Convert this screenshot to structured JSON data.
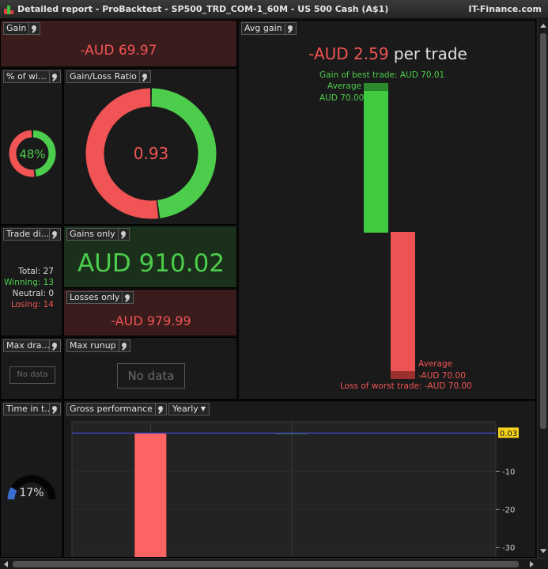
{
  "window": {
    "title": "Detailed report - ProBacktest - SP500_TRD_COM-1_60M - US 500 Cash (A$1)",
    "brand": "IT-Finance.com"
  },
  "gain": {
    "label": "Gain",
    "value": "-AUD 69.97"
  },
  "pct_winning": {
    "label": "% of wi...",
    "value": "48%",
    "fraction": 0.48
  },
  "gain_loss_ratio": {
    "label": "Gain/Loss Ratio",
    "value": "0.93",
    "green_fraction": 0.48
  },
  "avg_gain": {
    "label": "Avg gain",
    "value": "-AUD 2.59",
    "suffix": "per trade",
    "best_label": "Gain of best trade: AUD 70.01",
    "avg_pos_label": "Average",
    "avg_pos_value": "AUD 70.00",
    "avg_neg_label": "Average",
    "avg_neg_value": "-AUD 70.00",
    "worst_label": "Loss of worst trade: -AUD 70.00"
  },
  "trade_dist": {
    "label": "Trade di...",
    "total_label": "Total:",
    "total": "27",
    "winning_label": "Winning:",
    "winning": "13",
    "neutral_label": "Neutral:",
    "neutral": "0",
    "losing_label": "Losing:",
    "losing": "14"
  },
  "gains_only": {
    "label": "Gains only",
    "value": "AUD 910.02"
  },
  "losses_only": {
    "label": "Losses only",
    "value": "-AUD 979.99"
  },
  "max_drawdown": {
    "label": "Max dra...",
    "nodata": "No data"
  },
  "max_runup": {
    "label": "Max runup",
    "nodata": "No data"
  },
  "time_in_trade": {
    "label": "Time in t...",
    "value": "17%",
    "fraction": 0.17
  },
  "gross_perf": {
    "label": "Gross performance",
    "period": "Yearly",
    "current_value": "0.03",
    "ticks": [
      "-10",
      "-20",
      "-30"
    ]
  },
  "chart_data": {
    "type": "bar",
    "title": "Gross performance",
    "values": [
      -69.97,
      0.03
    ],
    "ylim": [
      -33,
      3
    ],
    "yticks": [
      -10,
      -20,
      -30
    ],
    "reference_line": 0.03
  },
  "colors": {
    "gain_green": "#4ccd4c",
    "loss_red": "#f05454",
    "bar_red": "#ff6464",
    "accent_yellow": "#f5d21e",
    "ref_line_blue": "#4040c8",
    "gauge_blue": "#3a6fd0"
  }
}
